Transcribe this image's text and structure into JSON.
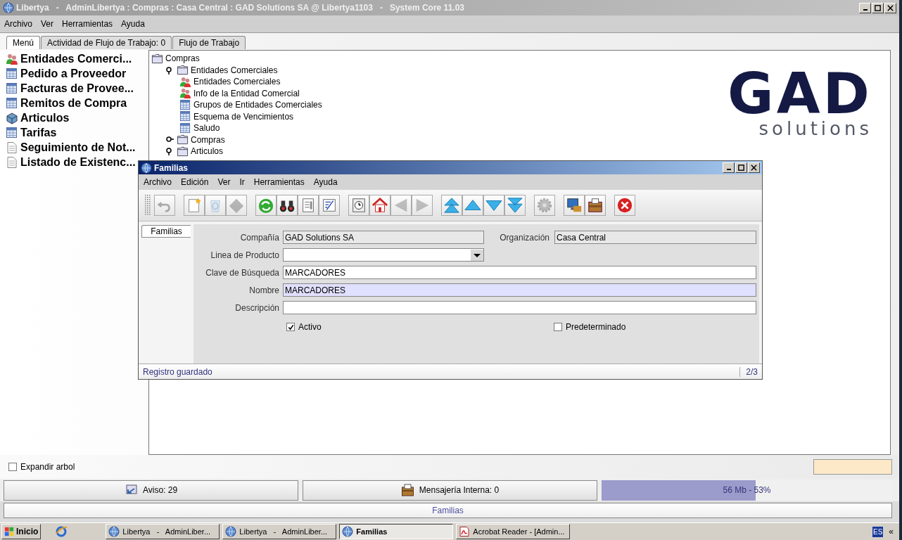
{
  "window": {
    "title": "Libertya   -   AdminLibertya : Compras : Casa Central : GAD Solutions SA @ Libertya1103   -   System Core 11.03"
  },
  "menu": [
    "Archivo",
    "Ver",
    "Herramientas",
    "Ayuda"
  ],
  "tabs": [
    {
      "label": "Menú",
      "selected": true
    },
    {
      "label": "Actividad de Flujo de Trabajo: 0",
      "selected": false
    },
    {
      "label": "Flujo de Trabajo",
      "selected": false
    }
  ],
  "sidebar": {
    "items": [
      {
        "label": "Entidades Comerci...",
        "kind": "people"
      },
      {
        "label": "Pedido a Proveedor",
        "kind": "table"
      },
      {
        "label": "Facturas de Provee...",
        "kind": "table"
      },
      {
        "label": "Remitos de Compra",
        "kind": "table"
      },
      {
        "label": "Articulos",
        "kind": "box"
      },
      {
        "label": "Tarifas",
        "kind": "table"
      },
      {
        "label": "Seguimiento de Not...",
        "kind": "doc"
      },
      {
        "label": "Listado de Existenc...",
        "kind": "doc"
      }
    ]
  },
  "tree": {
    "label": "Compras",
    "kind": "folder",
    "children": [
      {
        "label": "Entidades Comerciales",
        "kind": "folder",
        "expanded": true,
        "children": [
          {
            "label": "Entidades Comerciales",
            "kind": "people"
          },
          {
            "label": "Info de la Entidad Comercial",
            "kind": "people"
          },
          {
            "label": "Grupos de Entidades Comerciales",
            "kind": "table"
          },
          {
            "label": "Esquema de Vencimientos",
            "kind": "table"
          },
          {
            "label": "Saludo",
            "kind": "table"
          }
        ]
      },
      {
        "label": "Compras",
        "kind": "folder",
        "expanded": false
      },
      {
        "label": "Articulos",
        "kind": "folder",
        "expanded": true
      }
    ]
  },
  "logo": {
    "wordmark": "GAD",
    "tagline": "solutions"
  },
  "expand_tree": {
    "label": "Expandir arbol",
    "checked": false
  },
  "status_buttons": [
    {
      "label": "Aviso: 29",
      "kind": "alert"
    },
    {
      "label": "Mensajería Interna: 0",
      "kind": "mail"
    }
  ],
  "memory": {
    "label": "56 Mb - 53%",
    "level": 0.53
  },
  "active_window": "Familias",
  "dialog": {
    "title": "Familias",
    "menu": [
      "Archivo",
      "Edición",
      "Ver",
      "Ir",
      "Herramientas",
      "Ayuda"
    ],
    "toolbar": [
      [
        {
          "kind": "undo",
          "disabled": true
        }
      ],
      [
        {
          "kind": "new",
          "disabled": false
        },
        {
          "kind": "copy",
          "disabled": true
        },
        {
          "kind": "delete",
          "disabled": true
        }
      ],
      [
        {
          "kind": "refresh",
          "disabled": false
        },
        {
          "kind": "find",
          "disabled": false
        },
        {
          "kind": "detail",
          "disabled": false
        },
        {
          "kind": "grid",
          "disabled": false
        }
      ],
      [
        {
          "kind": "history",
          "disabled": false
        },
        {
          "kind": "home",
          "disabled": false
        },
        {
          "kind": "prev",
          "disabled": true
        },
        {
          "kind": "next",
          "disabled": true
        }
      ],
      [
        {
          "kind": "first",
          "disabled": false
        },
        {
          "kind": "up",
          "disabled": false
        },
        {
          "kind": "down",
          "disabled": false
        },
        {
          "kind": "last",
          "disabled": false
        }
      ],
      [
        {
          "kind": "process",
          "disabled": true
        }
      ],
      [
        {
          "kind": "report",
          "disabled": false
        },
        {
          "kind": "archive",
          "disabled": false
        }
      ],
      [
        {
          "kind": "close",
          "disabled": false
        }
      ]
    ],
    "tabs": [
      {
        "label": "Familias",
        "selected": true
      }
    ],
    "rows": [
      {
        "fields": [
          {
            "label": "Compañía",
            "value": "GAD Solutions SA",
            "kind": "readonly",
            "focused": false
          },
          {
            "label": "Organización",
            "value": "Casa Central",
            "kind": "readonly",
            "focused": false
          }
        ]
      },
      {
        "fields": [
          {
            "label": "Linea de Producto",
            "kind": "combo",
            "focused": false
          }
        ]
      },
      {
        "fields": [
          {
            "label": "Clave de Búsqueda",
            "value": "MARCADORES",
            "kind": "text",
            "focused": false
          }
        ]
      },
      {
        "fields": [
          {
            "label": "Nombre",
            "value": "MARCADORES",
            "kind": "text",
            "focused": true
          }
        ]
      },
      {
        "fields": [
          {
            "label": "Descripción",
            "kind": "text",
            "focused": false
          }
        ]
      }
    ],
    "checkboxes": [
      {
        "label": "Activo",
        "checked": true
      },
      {
        "label": "Predeterminado",
        "checked": false
      }
    ],
    "status": "Registro guardado",
    "record": "2/3"
  },
  "taskbar": {
    "start": "Inicio",
    "items": [
      {
        "label": "Libertya   -   AdminLiber...",
        "kind": "globe",
        "selected": false
      },
      {
        "label": "Libertya   -   AdminLiber...",
        "kind": "globe",
        "selected": false
      },
      {
        "label": "Familias",
        "kind": "globe",
        "selected": true
      },
      {
        "label": "Acrobat Reader - [Admin...",
        "kind": "pdf",
        "selected": false
      }
    ],
    "tray": [
      "ES",
      "«"
    ]
  }
}
